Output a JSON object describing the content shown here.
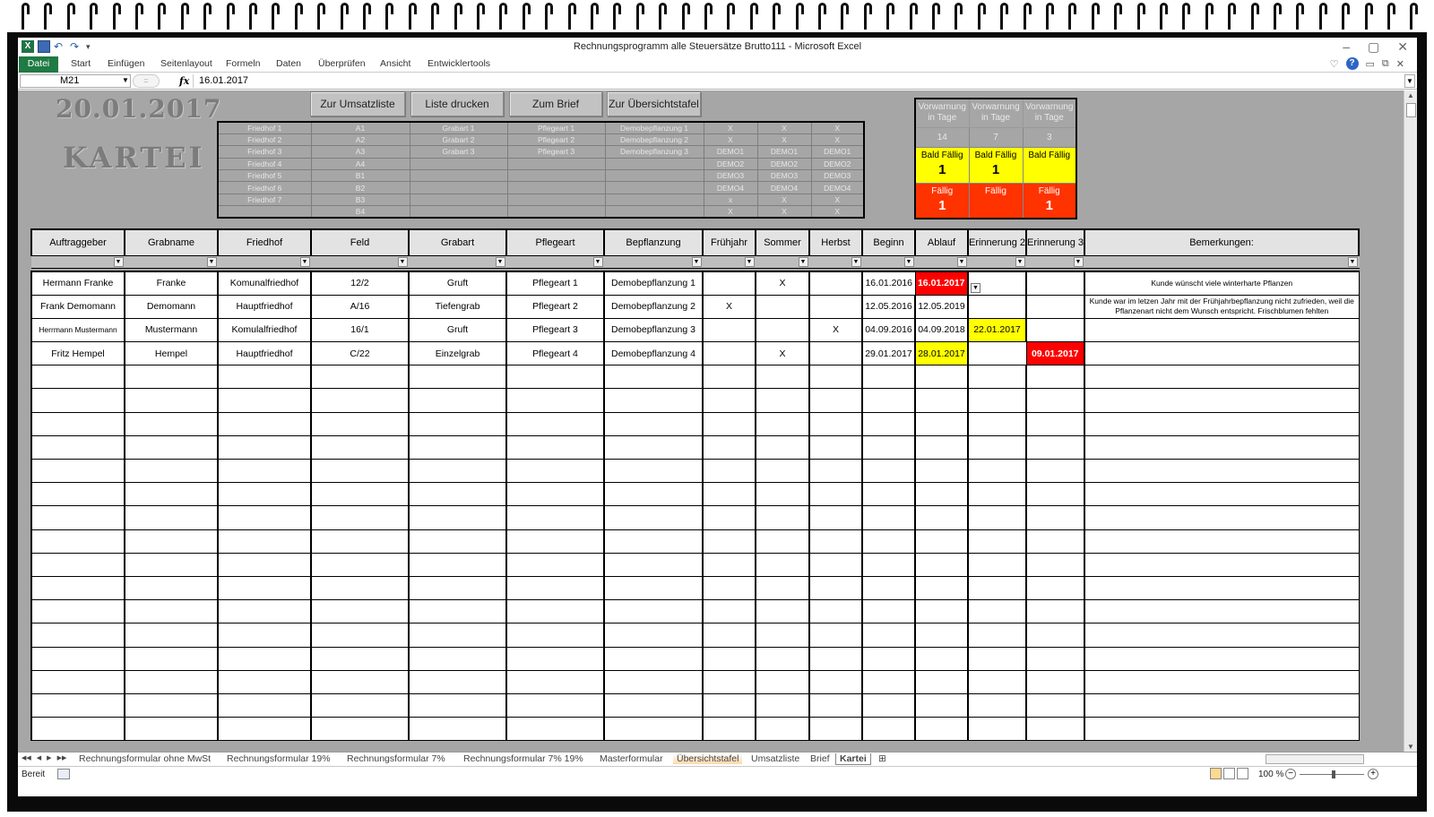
{
  "window": {
    "title": "Rechnungsprogramm alle Steuersätze Brutto111  -  Microsoft Excel"
  },
  "window_controls": [
    "–",
    "▢",
    "✕"
  ],
  "ribbon": {
    "file_tab": "Datei",
    "tabs": [
      "Start",
      "Einfügen",
      "Seitenlayout",
      "Formeln",
      "Daten",
      "Überprüfen",
      "Ansicht",
      "Entwicklertools"
    ],
    "help": "?"
  },
  "formula_bar": {
    "name_box": "M21",
    "fx": "fx",
    "value": "16.01.2017"
  },
  "sheet": {
    "big_date": "20.01.2017",
    "title": "KARTEI",
    "buttons": [
      "Zur Umsatzliste",
      "Liste drucken",
      "Zum Brief",
      "Zur Übersichtstafel"
    ],
    "lookup_rows": [
      [
        "Friedhof 1",
        "A1",
        "Grabart 1",
        "Pflegeart 1",
        "Demobepflanzung 1",
        "X",
        "X",
        "X"
      ],
      [
        "Friedhof 2",
        "A2",
        "Grabart 2",
        "Pflegeart 2",
        "Demobepflanzung 2",
        "X",
        "X",
        "X"
      ],
      [
        "Friedhof 3",
        "A3",
        "Grabart 3",
        "Pflegeart 3",
        "Demobepflanzung 3",
        "DEMO1",
        "DEMO1",
        "DEMO1"
      ],
      [
        "Friedhof 4",
        "A4",
        "",
        "",
        "",
        "DEMO2",
        "DEMO2",
        "DEMO2"
      ],
      [
        "Friedhof 5",
        "B1",
        "",
        "",
        "",
        "DEMO3",
        "DEMO3",
        "DEMO3"
      ],
      [
        "Friedhof 6",
        "B2",
        "",
        "",
        "",
        "DEMO4",
        "DEMO4",
        "DEMO4"
      ],
      [
        "Friedhof 7",
        "B3",
        "",
        "",
        "",
        "x",
        "X",
        "X"
      ],
      [
        "",
        "B4",
        "",
        "",
        "",
        "X",
        "X",
        "X"
      ]
    ],
    "reminder": {
      "headers": [
        "Vorwarnung in Tage",
        "Vorwarnung in Tage",
        "Vorwarnung in Tage"
      ],
      "days": [
        "14",
        "7",
        "3"
      ],
      "soon_label": "Bald Fällig",
      "soon_counts": [
        "1",
        "1",
        ""
      ],
      "due_label": "Fällig",
      "due_counts": [
        "1",
        "",
        "1"
      ]
    },
    "columns": [
      "Auftraggeber",
      "Grabname",
      "Friedhof",
      "Feld",
      "Grabart",
      "Pflegeart",
      "Bepflanzung",
      "Frühjahr",
      "Sommer",
      "Herbst",
      "Beginn",
      "Ablauf",
      "Erinnerung 2",
      "Erinnerung 3",
      "Bemerkungen:"
    ],
    "rows": [
      [
        "Hermann Franke",
        "Franke",
        "Komunalfriedhof",
        "12/2",
        "Gruft",
        "Pflegeart 1",
        "Demobepflanzung 1",
        "",
        "X",
        "",
        "16.01.2016",
        "16.01.2017",
        "",
        "",
        "Kunde wünscht viele winterharte Pflanzen"
      ],
      [
        "Frank Demomann",
        "Demomann",
        "Hauptfriedhof",
        "A/16",
        "Tiefengrab",
        "Pflegeart 2",
        "Demobepflanzung 2",
        "X",
        "",
        "",
        "12.05.2016",
        "12.05.2019",
        "",
        "",
        "Kunde war im letzen Jahr mit der Frühjahrbepflanzung nicht zufrieden, weil die Pflanzenart nicht dem Wunsch entspricht. Frischblumen fehlten"
      ],
      [
        "Herrmann Mustermann",
        "Mustermann",
        "Komulalfriedhof",
        "16/1",
        "Gruft",
        "Pflegeart 3",
        "Demobepflanzung 3",
        "",
        "",
        "X",
        "04.09.2016",
        "04.09.2018",
        "22.01.2017",
        "",
        ""
      ],
      [
        "Fritz Hempel",
        "Hempel",
        "Hauptfriedhof",
        "C/22",
        "Einzelgrab",
        "Pflegeart 4",
        "Demobepflanzung 4",
        "",
        "X",
        "",
        "29.01.2017",
        "28.01.2017",
        "",
        "09.01.2017",
        ""
      ]
    ],
    "cell_highlights": {
      "0": {
        "11": "red"
      },
      "2": {
        "12": "yel"
      },
      "3": {
        "11": "yel",
        "13": "red"
      }
    },
    "empty_rows": 16
  },
  "sheet_tabs": [
    "Rechnungsformular ohne MwSt",
    "Rechnungsformular 19%",
    "Rechnungsformular 7%",
    "Rechnungsformular 7% 19%",
    "Masterformular",
    "Übersichtstafel",
    "Umsatzliste",
    "Brief",
    "Kartei"
  ],
  "sheet_tab_nav": [
    "◀◀",
    "◀",
    "▶",
    "▶▶"
  ],
  "status": {
    "text": "Bereit",
    "zoom": "100 %",
    "zoom_value": 100
  },
  "colors": {
    "excel_green": "#1f7a44",
    "due_red": "#ff0000",
    "soon_yellow": "#ffff00",
    "sheet_gray": "#a6a6a6"
  },
  "icons": [
    "excel-logo-icon",
    "save-icon",
    "undo-icon",
    "redo-icon",
    "help-icon",
    "fx-icon",
    "filter-dropdown-icon"
  ]
}
